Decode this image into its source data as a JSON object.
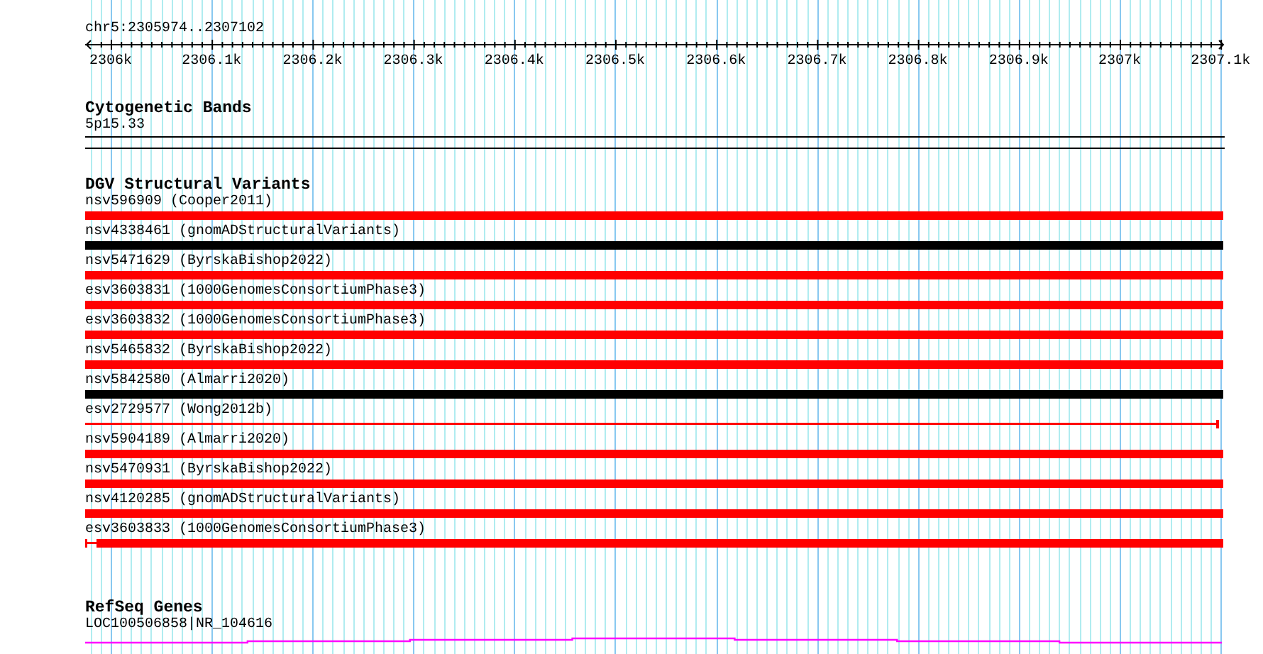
{
  "location": "chr5:2305974..2307102",
  "ruler": {
    "ticks": [
      "2306k",
      "2306.1k",
      "2306.2k",
      "2306.3k",
      "2306.4k",
      "2306.5k",
      "2306.6k",
      "2306.7k",
      "2306.8k",
      "2306.9k",
      "2307k",
      "2307.1k"
    ]
  },
  "tracks": [
    {
      "kind": "bands",
      "title": "Cytogenetic Bands",
      "features": [
        {
          "label": "5p15.33"
        }
      ]
    },
    {
      "kind": "variants",
      "title": "DGV Structural Variants",
      "features": [
        {
          "label": "nsv596909 (Cooper2011)",
          "kind": "bar",
          "color": "#ff0000"
        },
        {
          "label": "nsv4338461 (gnomADStructuralVariants)",
          "kind": "bar",
          "color": "#000000"
        },
        {
          "label": "nsv5471629 (ByrskaBishop2022)",
          "kind": "bar",
          "color": "#ff0000"
        },
        {
          "label": "esv3603831 (1000GenomesConsortiumPhase3)",
          "kind": "bar",
          "color": "#ff0000"
        },
        {
          "label": "esv3603832 (1000GenomesConsortiumPhase3)",
          "kind": "bar",
          "color": "#ff0000"
        },
        {
          "label": "nsv5465832 (ByrskaBishop2022)",
          "kind": "bar",
          "color": "#ff0000"
        },
        {
          "label": "nsv5842580 (Almarri2020)",
          "kind": "bar",
          "color": "#000000"
        },
        {
          "label": "esv2729577 (Wong2012b)",
          "kind": "line",
          "color": "#ff0000"
        },
        {
          "label": "nsv5904189 (Almarri2020)",
          "kind": "bar",
          "color": "#ff0000"
        },
        {
          "label": "nsv5470931 (ByrskaBishop2022)",
          "kind": "bar",
          "color": "#ff0000"
        },
        {
          "label": "nsv4120285 (gnomADStructuralVariants)",
          "kind": "bar",
          "color": "#ff0000"
        },
        {
          "label": "esv3603833 (1000GenomesConsortiumPhase3)",
          "kind": "capped-bar",
          "color": "#ff0000"
        }
      ]
    },
    {
      "kind": "genes",
      "title": "RefSeq Genes",
      "features": [
        {
          "label": "LOC100506858|NR_104616"
        }
      ]
    }
  ]
}
